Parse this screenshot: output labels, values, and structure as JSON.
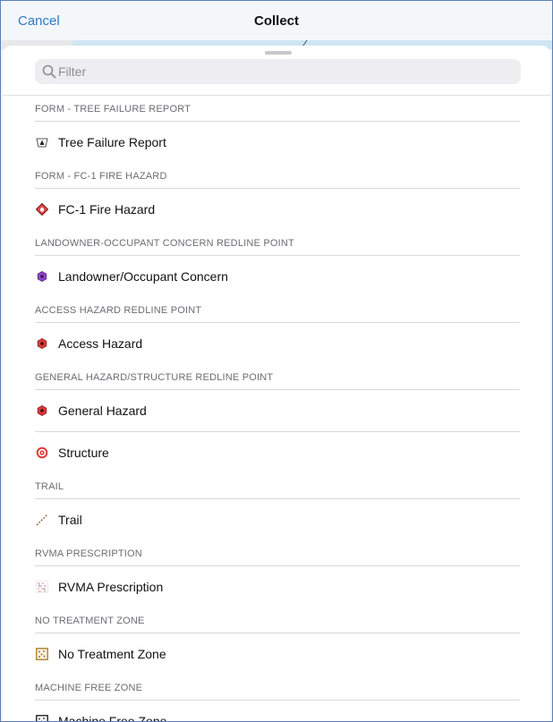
{
  "header": {
    "cancel_label": "Cancel",
    "title": "Collect"
  },
  "search": {
    "placeholder": "Filter",
    "value": ""
  },
  "sections": [
    {
      "title": "FORM - TREE FAILURE REPORT",
      "items": [
        {
          "label": "Tree Failure Report",
          "icon": "tree-failure-icon"
        }
      ]
    },
    {
      "title": "FORM - FC-1 FIRE HAZARD",
      "items": [
        {
          "label": "FC-1 Fire Hazard",
          "icon": "fire-hazard-icon"
        }
      ]
    },
    {
      "title": "LANDOWNER-OCCUPANT CONCERN REDLINE POINT",
      "items": [
        {
          "label": "Landowner/Occupant Concern",
          "icon": "purple-hexagon-icon"
        }
      ]
    },
    {
      "title": "ACCESS HAZARD REDLINE POINT",
      "items": [
        {
          "label": "Access Hazard",
          "icon": "red-hexagon-icon"
        }
      ]
    },
    {
      "title": "GENERAL HAZARD/STRUCTURE REDLINE POINT",
      "items": [
        {
          "label": "General Hazard",
          "icon": "red-hexagon-icon"
        },
        {
          "label": "Structure",
          "icon": "target-icon"
        }
      ]
    },
    {
      "title": "TRAIL",
      "items": [
        {
          "label": "Trail",
          "icon": "dashed-line-icon"
        }
      ]
    },
    {
      "title": "RVMA PRESCRIPTION",
      "items": [
        {
          "label": "RVMA Prescription",
          "icon": "pattern-polygon-icon"
        }
      ]
    },
    {
      "title": "NO TREATMENT ZONE",
      "items": [
        {
          "label": "No Treatment Zone",
          "icon": "brown-dotted-square-icon"
        }
      ]
    },
    {
      "title": "MACHINE FREE ZONE",
      "items": [
        {
          "label": "Machine Free Zone",
          "icon": "black-dotted-square-icon"
        }
      ]
    }
  ],
  "colors": {
    "accent": "#2f78c3",
    "purple_marker": "#8e44c8",
    "red_marker": "#d93a3a",
    "brown_zone": "#a8781e"
  }
}
